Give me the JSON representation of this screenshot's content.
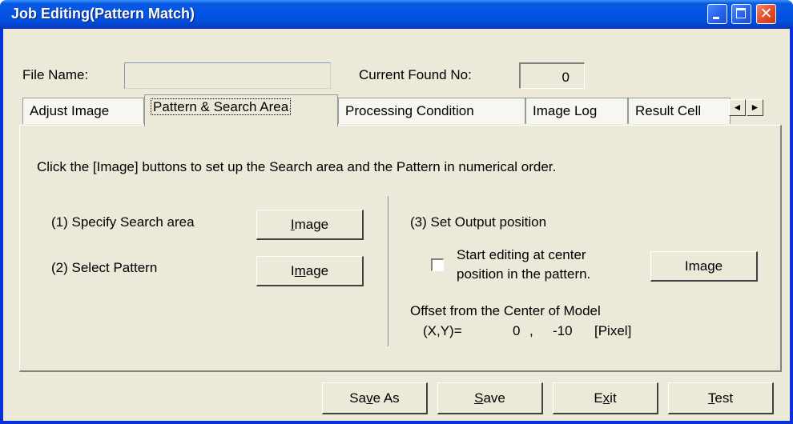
{
  "window": {
    "title": "Job Editing(Pattern Match)"
  },
  "header": {
    "file_name_label": "File Name:",
    "file_name_value": "",
    "current_found_label": "Current Found No:",
    "current_found_value": "0"
  },
  "tabs": [
    {
      "label": "Adjust Image",
      "active": false
    },
    {
      "label": "Pattern & Search Area",
      "active": true
    },
    {
      "label": "Processing Condition",
      "active": false
    },
    {
      "label": "Image Log",
      "active": false
    },
    {
      "label": "Result Cell",
      "active": false
    }
  ],
  "tab_scroll": {
    "left": "◄",
    "right": "►"
  },
  "panel": {
    "instruction": "Click the [Image] buttons to set up the Search area and the Pattern in numerical order.",
    "step1_label": "(1) Specify Search area",
    "step1_button": {
      "pre": "",
      "mnemonic": "I",
      "post": "mage"
    },
    "step2_label": "(2) Select Pattern",
    "step2_button": {
      "pre": "I",
      "mnemonic": "m",
      "post": "age"
    },
    "step3_label": "(3) Set Output position",
    "checkbox_line1": "Start editing at center",
    "checkbox_line2": "position in the pattern.",
    "checkbox_checked": false,
    "step3_button": {
      "pre": "Ima",
      "mnemonic": "g",
      "post": "e"
    },
    "offset_label": "Offset from the Center of Model",
    "offset_xy_label": "(X,Y)=",
    "offset_x": "0",
    "offset_sep": ",",
    "offset_y": "-10",
    "offset_unit": "[Pixel]"
  },
  "footer_buttons": {
    "save_as": {
      "pre": "Sa",
      "mnemonic": "v",
      "post": "e As"
    },
    "save": {
      "pre": "",
      "mnemonic": "S",
      "post": "ave"
    },
    "exit": {
      "pre": "E",
      "mnemonic": "x",
      "post": "it"
    },
    "test": {
      "pre": "",
      "mnemonic": "T",
      "post": "est"
    }
  }
}
